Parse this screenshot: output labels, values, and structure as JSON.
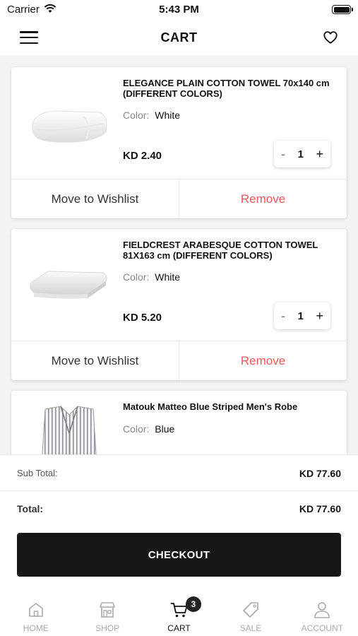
{
  "status": {
    "carrier": "Carrier",
    "time": "5:43 PM"
  },
  "header": {
    "title": "CART"
  },
  "colors": {
    "remove": "#e85a5a",
    "checkout_bg": "#161616"
  },
  "cart": {
    "color_label": "Color:",
    "move_label": "Move to Wishlist",
    "remove_label": "Remove",
    "qty_minus": "-",
    "qty_plus": "+",
    "items": [
      {
        "name": "ELEGANCE PLAIN COTTON TOWEL 70x140 cm (DIFFERENT COLORS)",
        "color": "White",
        "price": "KD  2.40",
        "qty": "1",
        "image": "folded-towel"
      },
      {
        "name": "FIELDCREST ARABESQUE COTTON TOWEL 81X163 cm (DIFFERENT COLORS)",
        "color": "White",
        "price": "KD  5.20",
        "qty": "1",
        "image": "folded-towel"
      },
      {
        "name": "Matouk Matteo Blue Striped Men's Robe",
        "color": "Blue",
        "price": "",
        "qty": "",
        "image": "striped-robe"
      }
    ]
  },
  "summary": {
    "subtotal_label": "Sub Total:",
    "subtotal_value": "KD  77.60",
    "total_label": "Total:",
    "total_value": "KD  77.60",
    "checkout_label": "CHECKOUT"
  },
  "tabs": [
    {
      "label": "HOME",
      "icon": "home-icon"
    },
    {
      "label": "SHOP",
      "icon": "shop-icon"
    },
    {
      "label": "CART",
      "icon": "cart-icon",
      "badge": "3",
      "active": true
    },
    {
      "label": "SALE",
      "icon": "tag-icon"
    },
    {
      "label": "ACCOUNT",
      "icon": "person-icon"
    }
  ]
}
